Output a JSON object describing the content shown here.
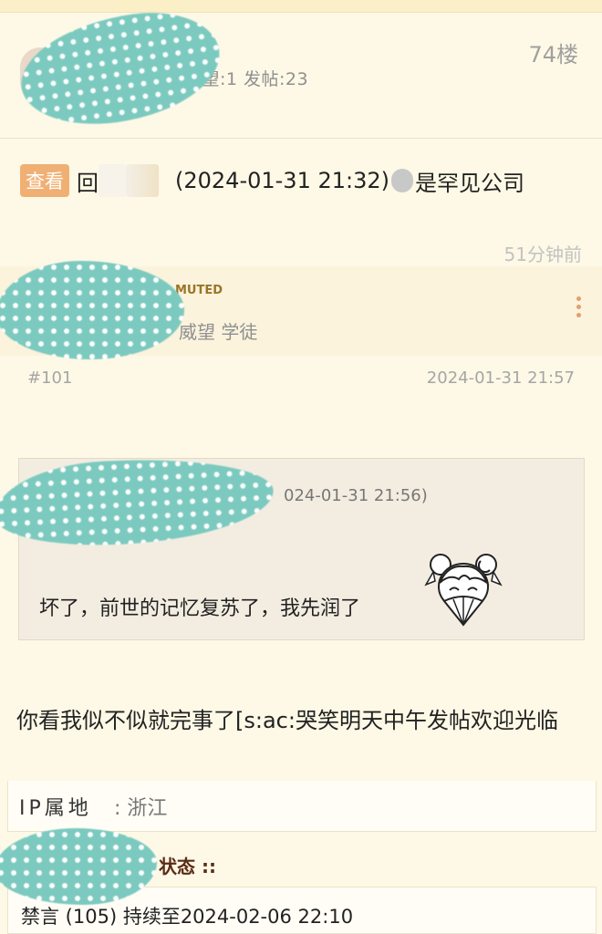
{
  "post_prev": {
    "floor": "74楼",
    "meta": "别:学徒 威望:1 发帖:23",
    "dash": "-"
  },
  "reply": {
    "tag": "查看",
    "prefix": "回",
    "time": "(2024-01-31 21:32)",
    "suffix": "是罕见公司"
  },
  "time_ago": "51分钟前",
  "post": {
    "badge": "MUTED",
    "rank": "威望 学徒",
    "number": "#101",
    "datetime": "2024-01-31 21:57",
    "quote_time": "024-01-31 21:56)",
    "quote_text": "坏了，前世的记忆复苏了，我先润了",
    "body": "你看我似不似就完事了[s:ac:哭笑明天中午发帖欢迎光临",
    "ip_label": "IP属地",
    "ip_sep": ":",
    "ip_value": "浙江",
    "status_title": "状态 ::",
    "ban_text": "禁言 (105) 持续至2024-02-06 22:10"
  }
}
